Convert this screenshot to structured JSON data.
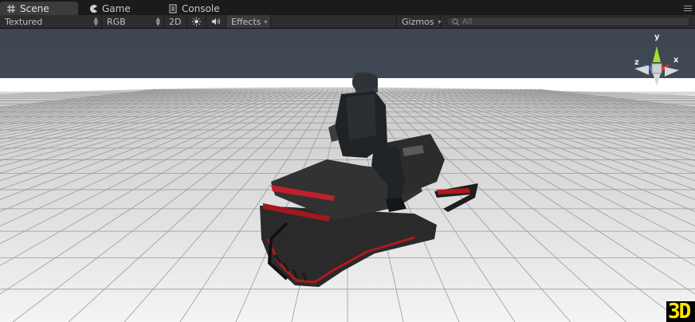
{
  "tabs": [
    {
      "label": "Scene",
      "icon": "grid-icon",
      "active": true
    },
    {
      "label": "Game",
      "icon": "pacman-icon",
      "active": false
    },
    {
      "label": "Console",
      "icon": "console-icon",
      "active": false
    }
  ],
  "toolbar": {
    "draw_mode": "Textured",
    "render_mode": "RGB",
    "mode_2d": "2D",
    "effects": "Effects",
    "gizmos": "Gizmos",
    "search_placeholder": "All"
  },
  "gizmo": {
    "y": "y",
    "x": "x",
    "z": "z"
  },
  "corner_badge": "3D",
  "colors": {
    "accent_x": "#e03a2a",
    "accent_y": "#a0e030",
    "accent_z": "#3a6fe0",
    "badge": "#ffe600"
  }
}
